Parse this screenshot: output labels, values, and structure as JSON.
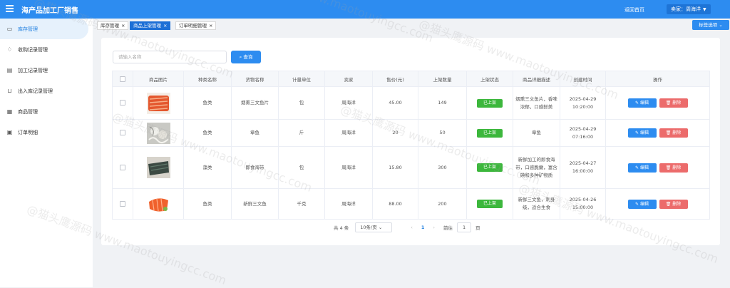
{
  "header": {
    "title": "海产品加工厂销售",
    "home_link": "返回首页",
    "user": "卖家：周海洋"
  },
  "sidebar": {
    "items": [
      {
        "label": "库存管理",
        "icon": "folder-icon",
        "active": true
      },
      {
        "label": "收购记录管理",
        "icon": "hand-icon"
      },
      {
        "label": "加工记录管理",
        "icon": "document-icon"
      },
      {
        "label": "出入库记录管理",
        "icon": "inbox-icon"
      },
      {
        "label": "商品管理",
        "icon": "box-icon"
      },
      {
        "label": "订单明细",
        "icon": "clipboard-icon"
      }
    ]
  },
  "tabs": [
    {
      "label": "库存管理",
      "close": "×"
    },
    {
      "label": "商品上架管理",
      "close": "×",
      "active": true
    },
    {
      "label": "订单明细管理",
      "close": "×"
    }
  ],
  "tag_button": "标签选项",
  "search": {
    "placeholder": "请输入名称",
    "button": "查询"
  },
  "table": {
    "headers": [
      "商品图片",
      "种类名称",
      "货物名称",
      "计量单位",
      "卖家",
      "售价(元)",
      "上架数量",
      "上架状态",
      "商品详细描述",
      "创建时间",
      "操作"
    ],
    "edit_label": "编辑",
    "delete_label": "删除",
    "rows": [
      {
        "category": "鱼类",
        "name": "烟熏三文鱼片",
        "unit": "包",
        "seller": "周海洋",
        "price": "45.00",
        "qty": "149",
        "status": "已上架",
        "desc": "烟熏三文鱼片，香味浓郁，口感鲜美",
        "time": "2025-04-29 10:20:00",
        "thumb": "salmon-slices"
      },
      {
        "category": "鱼类",
        "name": "章鱼",
        "unit": "斤",
        "seller": "周海洋",
        "price": "20",
        "qty": "50",
        "status": "已上架",
        "desc": "章鱼",
        "time": "2025-04-29 07:16:00",
        "thumb": "octopus"
      },
      {
        "category": "藻类",
        "name": "即食海带",
        "unit": "包",
        "seller": "周海洋",
        "price": "15.80",
        "qty": "300",
        "status": "已上架",
        "desc": "新鲜加工的即食海带，口感脆嫩，富含碘和多种矿物质",
        "time": "2025-04-27 16:00:00",
        "thumb": "kelp"
      },
      {
        "category": "鱼类",
        "name": "新鲜三文鱼",
        "unit": "千克",
        "seller": "周海洋",
        "price": "88.00",
        "qty": "200",
        "status": "已上架",
        "desc": "新鲜三文鱼，刺身级，适合生食",
        "time": "2025-04-26 15:00:00",
        "thumb": "salmon-fillet"
      }
    ]
  },
  "pagination": {
    "total": "共 4 条",
    "page_size": "10条/页",
    "current": "1",
    "goto_label": "前往",
    "goto_value": "1",
    "page_suffix": "页"
  },
  "watermark": "@猫头鹰源码 www.maotouyingcc.com"
}
